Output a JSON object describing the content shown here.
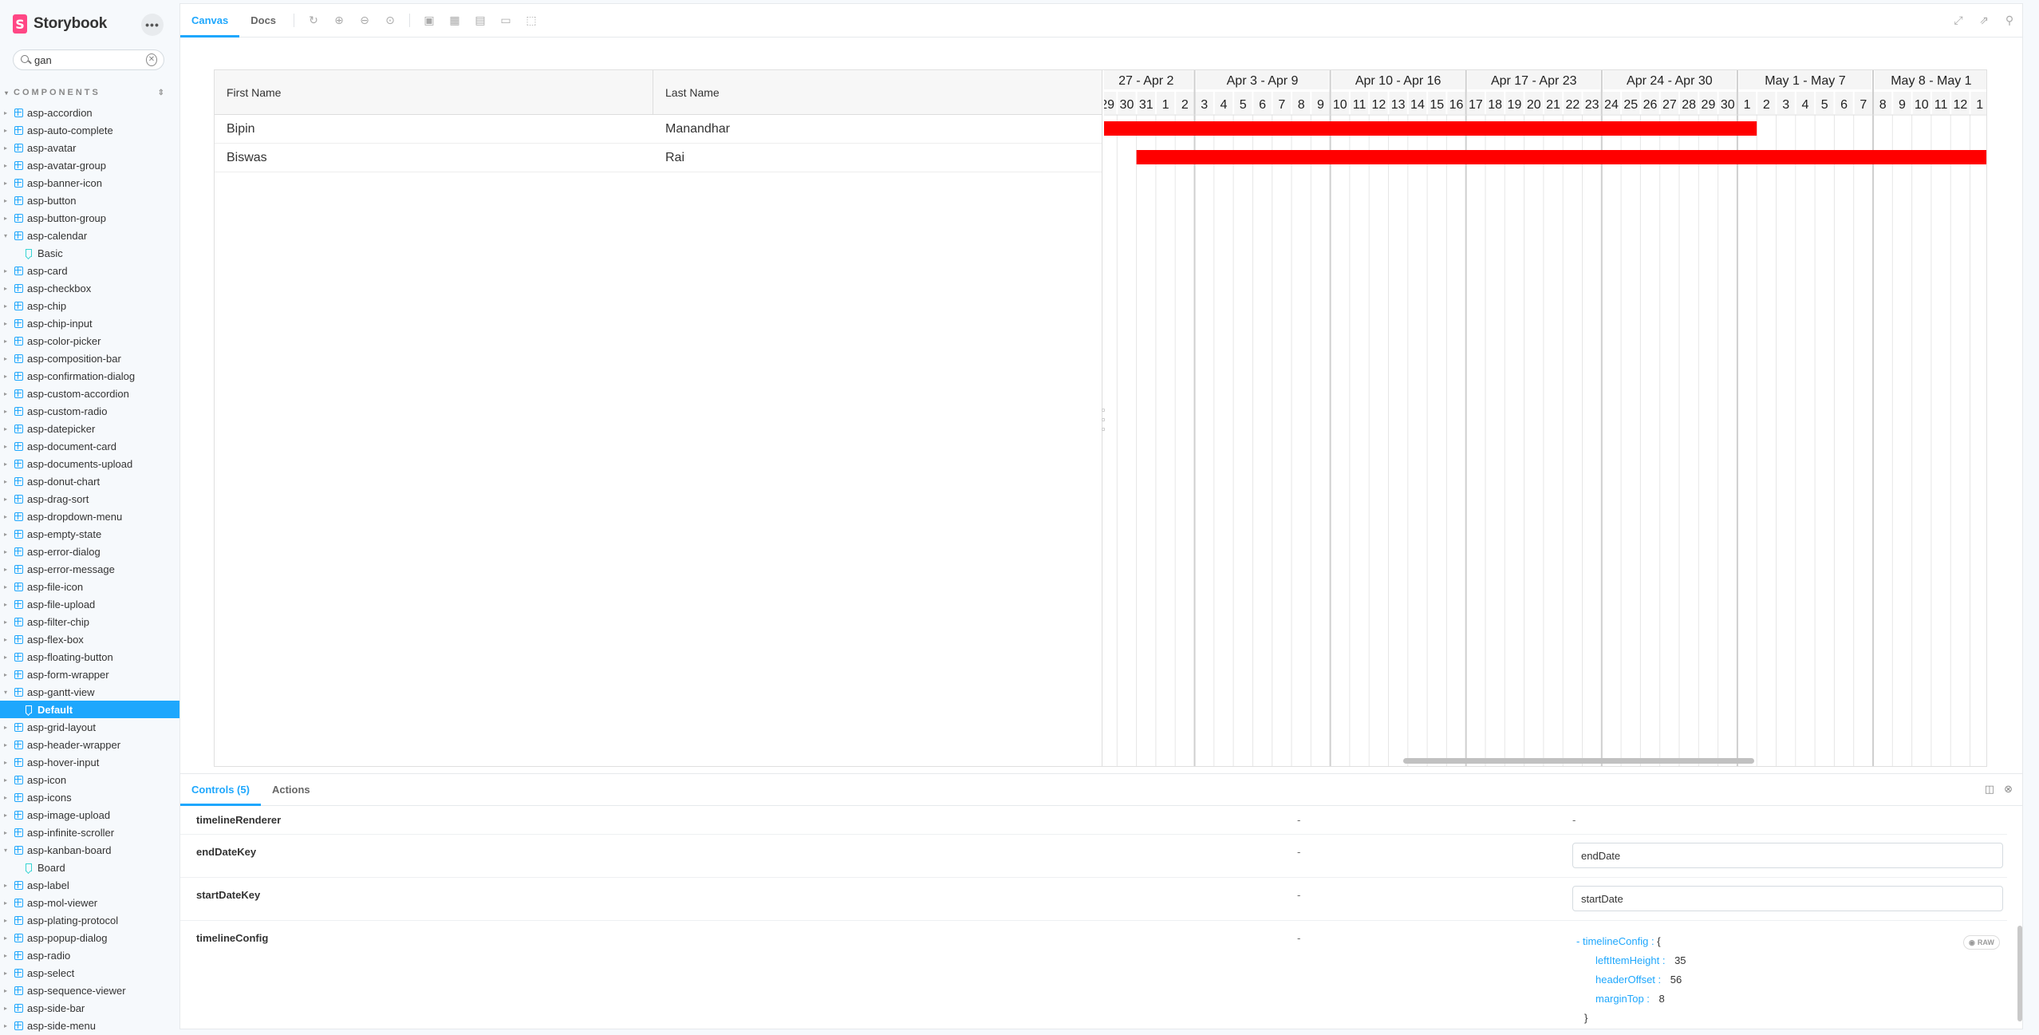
{
  "sidebar": {
    "brand": "Storybook",
    "search_value": "gan",
    "section_title": "COMPONENTS",
    "items": [
      {
        "label": "asp-accordion",
        "type": "component"
      },
      {
        "label": "asp-auto-complete",
        "type": "component"
      },
      {
        "label": "asp-avatar",
        "type": "component"
      },
      {
        "label": "asp-avatar-group",
        "type": "component"
      },
      {
        "label": "asp-banner-icon",
        "type": "component"
      },
      {
        "label": "asp-button",
        "type": "component"
      },
      {
        "label": "asp-button-group",
        "type": "component"
      },
      {
        "label": "asp-calendar",
        "type": "component",
        "expanded": true
      },
      {
        "label": "Basic",
        "type": "story"
      },
      {
        "label": "asp-card",
        "type": "component"
      },
      {
        "label": "asp-checkbox",
        "type": "component"
      },
      {
        "label": "asp-chip",
        "type": "component"
      },
      {
        "label": "asp-chip-input",
        "type": "component"
      },
      {
        "label": "asp-color-picker",
        "type": "component"
      },
      {
        "label": "asp-composition-bar",
        "type": "component"
      },
      {
        "label": "asp-confirmation-dialog",
        "type": "component"
      },
      {
        "label": "asp-custom-accordion",
        "type": "component"
      },
      {
        "label": "asp-custom-radio",
        "type": "component"
      },
      {
        "label": "asp-datepicker",
        "type": "component"
      },
      {
        "label": "asp-document-card",
        "type": "component"
      },
      {
        "label": "asp-documents-upload",
        "type": "component"
      },
      {
        "label": "asp-donut-chart",
        "type": "component"
      },
      {
        "label": "asp-drag-sort",
        "type": "component"
      },
      {
        "label": "asp-dropdown-menu",
        "type": "component"
      },
      {
        "label": "asp-empty-state",
        "type": "component"
      },
      {
        "label": "asp-error-dialog",
        "type": "component"
      },
      {
        "label": "asp-error-message",
        "type": "component"
      },
      {
        "label": "asp-file-icon",
        "type": "component"
      },
      {
        "label": "asp-file-upload",
        "type": "component"
      },
      {
        "label": "asp-filter-chip",
        "type": "component"
      },
      {
        "label": "asp-flex-box",
        "type": "component"
      },
      {
        "label": "asp-floating-button",
        "type": "component"
      },
      {
        "label": "asp-form-wrapper",
        "type": "component"
      },
      {
        "label": "asp-gantt-view",
        "type": "component",
        "expanded": true
      },
      {
        "label": "Default",
        "type": "story",
        "selected": true
      },
      {
        "label": "asp-grid-layout",
        "type": "component"
      },
      {
        "label": "asp-header-wrapper",
        "type": "component"
      },
      {
        "label": "asp-hover-input",
        "type": "component"
      },
      {
        "label": "asp-icon",
        "type": "component"
      },
      {
        "label": "asp-icons",
        "type": "component"
      },
      {
        "label": "asp-image-upload",
        "type": "component"
      },
      {
        "label": "asp-infinite-scroller",
        "type": "component"
      },
      {
        "label": "asp-kanban-board",
        "type": "component",
        "expanded": true
      },
      {
        "label": "Board",
        "type": "story"
      },
      {
        "label": "asp-label",
        "type": "component"
      },
      {
        "label": "asp-mol-viewer",
        "type": "component"
      },
      {
        "label": "asp-plating-protocol",
        "type": "component"
      },
      {
        "label": "asp-popup-dialog",
        "type": "component"
      },
      {
        "label": "asp-radio",
        "type": "component"
      },
      {
        "label": "asp-select",
        "type": "component"
      },
      {
        "label": "asp-sequence-viewer",
        "type": "component"
      },
      {
        "label": "asp-side-bar",
        "type": "component"
      },
      {
        "label": "asp-side-menu",
        "type": "component"
      }
    ]
  },
  "toolbar": {
    "tab_canvas": "Canvas",
    "tab_docs": "Docs"
  },
  "grid": {
    "col_first": "First Name",
    "col_last": "Last Name",
    "rows": [
      {
        "first": "Bipin",
        "last": "Manandhar"
      },
      {
        "first": "Biswas",
        "last": "Rai"
      }
    ]
  },
  "gantt": {
    "bar_color": "#ff0000",
    "weeks": [
      {
        "label": "27 - Apr 2",
        "days": [
          "29",
          "30",
          "31",
          "1",
          "2"
        ]
      },
      {
        "label": "Apr 3 - Apr 9",
        "days": [
          "3",
          "4",
          "5",
          "6",
          "7",
          "8",
          "9"
        ]
      },
      {
        "label": "Apr 10 - Apr 16",
        "days": [
          "10",
          "11",
          "12",
          "13",
          "14",
          "15",
          "16"
        ]
      },
      {
        "label": "Apr 17 - Apr 23",
        "days": [
          "17",
          "18",
          "19",
          "20",
          "21",
          "22",
          "23"
        ]
      },
      {
        "label": "Apr 24 - Apr 30",
        "days": [
          "24",
          "25",
          "26",
          "27",
          "28",
          "29",
          "30"
        ]
      },
      {
        "label": "May 1 - May 7",
        "days": [
          "1",
          "2",
          "3",
          "4",
          "5",
          "6",
          "7"
        ]
      },
      {
        "label": "May 8 - May 1",
        "days": [
          "8",
          "9",
          "10",
          "11",
          "12",
          "1"
        ]
      }
    ],
    "bars": [
      {
        "row": 0,
        "start_day_index": 0,
        "end_day_index": 34
      },
      {
        "row": 1,
        "start_day_index": 2,
        "end_day_index": 46
      }
    ]
  },
  "addons": {
    "tab_controls": "Controls (5)",
    "tab_actions": "Actions",
    "controls": [
      {
        "name": "timelineRenderer",
        "description": "-",
        "value": "-"
      },
      {
        "name": "endDateKey",
        "description": "-",
        "value": "endDate"
      },
      {
        "name": "startDateKey",
        "description": "-",
        "value": "startDate"
      },
      {
        "name": "timelineConfig",
        "description": "-"
      }
    ],
    "timeline_config": {
      "root_label": "timelineConfig :",
      "open_brace": "{",
      "close_brace": "}",
      "entries": [
        {
          "key": "leftItemHeight :",
          "value": "35"
        },
        {
          "key": "headerOffset :",
          "value": "56"
        },
        {
          "key": "marginTop :",
          "value": "8"
        }
      ],
      "raw_label": "RAW"
    }
  }
}
